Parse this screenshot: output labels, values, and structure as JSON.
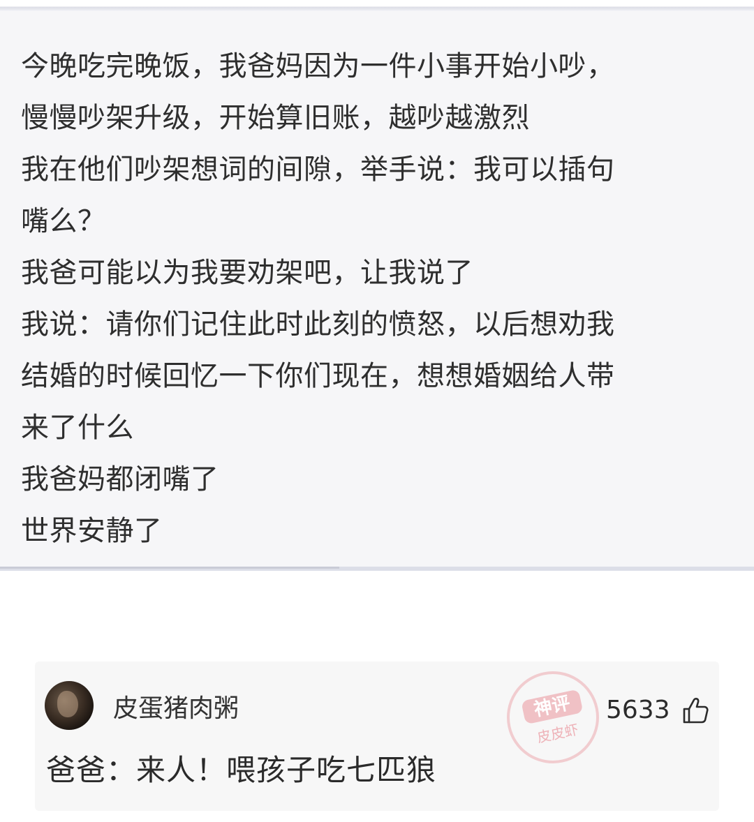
{
  "post": {
    "lines": [
      "今晚吃完晚饭，我爸妈因为一件小事开始小吵，",
      "慢慢吵架升级，开始算旧账，越吵越激烈",
      "我在他们吵架想词的间隙，举手说：我可以插句",
      "嘴么？",
      "我爸可能以为我要劝架吧，让我说了",
      "我说：请你们记住此时此刻的愤怒，以后想劝我",
      "结婚的时候回忆一下你们现在，想想婚姻给人带",
      "来了什么",
      "我爸妈都闭嘴了",
      "世界安静了"
    ]
  },
  "comment": {
    "username": "皮蛋猪肉粥",
    "likes": "5633",
    "text": "爸爸：来人！喂孩子吃七匹狼",
    "avatar_icon": "user-avatar",
    "like_icon": "thumbs-up-icon"
  },
  "watermark": {
    "top_text": "神评",
    "bottom_text": "皮皮虾",
    "color": "#e25c68"
  }
}
